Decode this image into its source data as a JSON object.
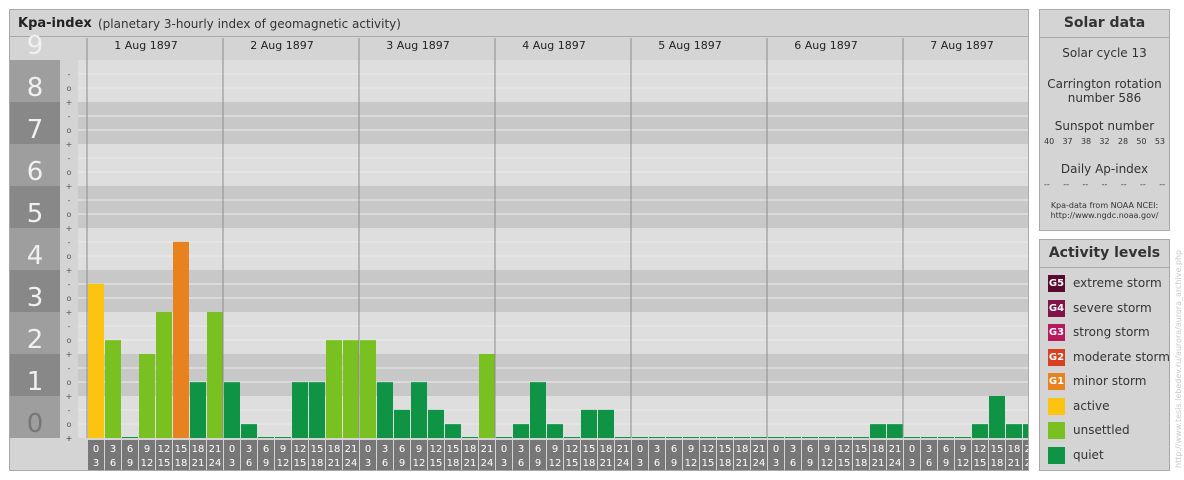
{
  "header": {
    "title": "Kpa-index",
    "subtitle": "(planetary 3-hourly index of geomagnetic activity)"
  },
  "solar": {
    "title": "Solar data",
    "cycle": "Solar cycle 13",
    "carrington_line1": "Carrington rotation",
    "carrington_line2": "number 586",
    "sunspot_label": "Sunspot number",
    "sunspot_values": [
      "40",
      "37",
      "38",
      "32",
      "28",
      "50",
      "53"
    ],
    "ap_label": "Daily Ap-index",
    "ap_values": [
      "--",
      "--",
      "--",
      "--",
      "--",
      "--",
      "--"
    ],
    "credit_line1": "Kpa-data from NOAA NCEI:",
    "credit_line2": "http://www.ngdc.noaa.gov/"
  },
  "activity": {
    "title": "Activity levels",
    "levels": [
      {
        "code": "G5",
        "label": "extreme storm",
        "color": "#5a0a2e"
      },
      {
        "code": "G4",
        "label": "severe storm",
        "color": "#80144a"
      },
      {
        "code": "G3",
        "label": "strong storm",
        "color": "#b8185c"
      },
      {
        "code": "G2",
        "label": "moderate storm",
        "color": "#d8401f"
      },
      {
        "code": "G1",
        "label": "minor storm",
        "color": "#e8821e"
      },
      {
        "code": "",
        "label": "active",
        "color": "#fcc411"
      },
      {
        "code": "",
        "label": "unsettled",
        "color": "#79c120"
      },
      {
        "code": "",
        "label": "quiet",
        "color": "#0f9446"
      }
    ]
  },
  "watermark": "http://www.tesis.lebedev.ru/aurora/aurora_archive.php",
  "chart_data": {
    "type": "bar",
    "title": "Kpa-index",
    "subtitle": "(planetary 3-hourly index of geomagnetic activity)",
    "ylim": [
      0,
      9
    ],
    "y_ticks": [
      "0",
      "1",
      "2",
      "3",
      "4",
      "5",
      "6",
      "7",
      "8",
      "9"
    ],
    "minor_tick_labels": [
      "+",
      "o",
      "-"
    ],
    "days": [
      "1 Aug 1897",
      "2 Aug 1897",
      "3 Aug 1897",
      "4 Aug 1897",
      "5 Aug 1897",
      "6 Aug 1897",
      "7 Aug 1897"
    ],
    "interval_top": [
      "0",
      "3",
      "6",
      "9",
      "12",
      "15",
      "18",
      "21"
    ],
    "interval_bottom": [
      "3",
      "6",
      "9",
      "12",
      "15",
      "18",
      "21",
      "24"
    ],
    "values": [
      [
        3.67,
        2.33,
        0.0,
        2.0,
        3.0,
        4.67,
        1.33,
        3.0
      ],
      [
        1.33,
        0.33,
        0.0,
        0.0,
        1.33,
        1.33,
        2.33,
        2.33
      ],
      [
        2.33,
        1.33,
        0.67,
        1.33,
        0.67,
        0.33,
        0.0,
        2.0
      ],
      [
        0.0,
        0.33,
        1.33,
        0.33,
        0.0,
        0.67,
        0.67,
        0.0
      ],
      [
        0.0,
        0.0,
        0.0,
        0.0,
        0.0,
        0.0,
        0.0,
        0.0
      ],
      [
        0.0,
        0.0,
        0.0,
        0.0,
        0.0,
        0.0,
        0.33,
        0.33
      ],
      [
        0.0,
        0.0,
        0.0,
        0.0,
        0.33,
        1.0,
        0.33,
        0.33
      ]
    ],
    "colors": {
      "quiet": "#0f9446",
      "unsettled": "#79c120",
      "active": "#fcc411",
      "minor_storm": "#e8821e"
    },
    "grid": true
  }
}
